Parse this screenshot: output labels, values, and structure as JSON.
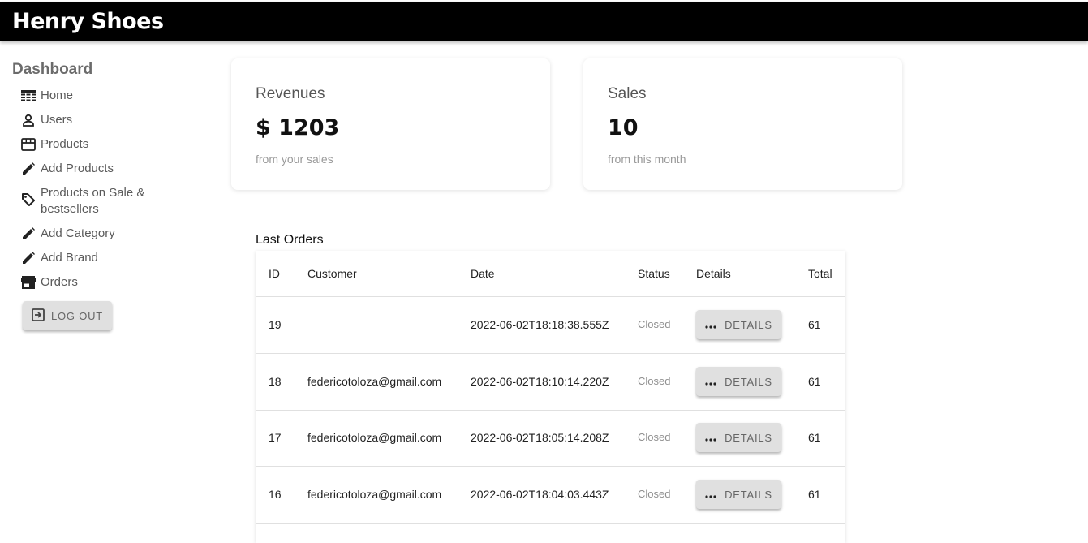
{
  "header": {
    "brand": "Henry Shoes"
  },
  "sidebar": {
    "title": "Dashboard",
    "items": [
      {
        "label": "Home",
        "icon": "dashboard-table-icon"
      },
      {
        "label": "Users",
        "icon": "person-icon"
      },
      {
        "label": "Products",
        "icon": "store-icon"
      },
      {
        "label": "Add Products",
        "icon": "pencil-icon"
      },
      {
        "label": "Products on Sale & bestsellers",
        "icon": "tag-icon"
      },
      {
        "label": "Add Category",
        "icon": "pencil-icon"
      },
      {
        "label": "Add Brand",
        "icon": "pencil-icon"
      },
      {
        "label": "Orders",
        "icon": "storefront-icon"
      }
    ],
    "logout_label": "LOG OUT"
  },
  "cards": {
    "revenues": {
      "title": "Revenues",
      "value": "$ 1203",
      "subtitle": "from your sales"
    },
    "sales": {
      "title": "Sales",
      "value": "10",
      "subtitle": "from this month"
    }
  },
  "orders": {
    "title": "Last Orders",
    "columns": [
      "ID",
      "Customer",
      "Date",
      "Status",
      "Details",
      "Total"
    ],
    "details_label": "DETAILS",
    "rows": [
      {
        "id": "19",
        "customer": "",
        "date": "2022-06-02T18:18:38.555Z",
        "status": "Closed",
        "total": "61"
      },
      {
        "id": "18",
        "customer": "federicotoloza@gmail.com",
        "date": "2022-06-02T18:10:14.220Z",
        "status": "Closed",
        "total": "61"
      },
      {
        "id": "17",
        "customer": "federicotoloza@gmail.com",
        "date": "2022-06-02T18:05:14.208Z",
        "status": "Closed",
        "total": "61"
      },
      {
        "id": "16",
        "customer": "federicotoloza@gmail.com",
        "date": "2022-06-02T18:04:03.443Z",
        "status": "Closed",
        "total": "61"
      }
    ]
  }
}
